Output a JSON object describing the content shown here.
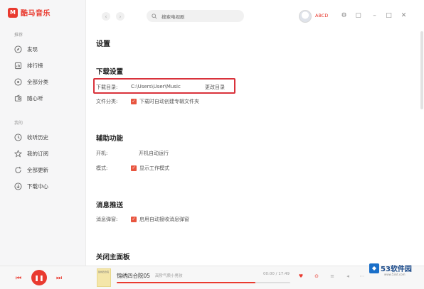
{
  "app": {
    "name": "酷马音乐",
    "logo_glyph": "M"
  },
  "sidebar": {
    "section_recommend": "推荐",
    "section_mine": "我的",
    "recommend_items": [
      {
        "label": "发现",
        "icon": "compass-icon"
      },
      {
        "label": "排行榜",
        "icon": "chart-icon"
      },
      {
        "label": "全部分类",
        "icon": "grid-icon"
      },
      {
        "label": "随心听",
        "icon": "radio-icon"
      }
    ],
    "mine_items": [
      {
        "label": "收听历史",
        "icon": "clock-icon"
      },
      {
        "label": "我的订阅",
        "icon": "star-icon"
      },
      {
        "label": "全部更新",
        "icon": "refresh-icon"
      },
      {
        "label": "下载中心",
        "icon": "download-icon"
      }
    ]
  },
  "topbar": {
    "search_value": "搜索电视剧",
    "username": "ABCD"
  },
  "settings": {
    "page_title": "设置",
    "download": {
      "title": "下载设置",
      "dir_label": "下载目录:",
      "dir_path": "C:\\Users\\User\\Music",
      "change_button": "更改目录",
      "file_group_label": "文件分类:",
      "file_group_option": "下载时自动创建专辑文件夹",
      "file_group_checked": true
    },
    "assist": {
      "title": "辅助功能",
      "startup_label": "开机:",
      "startup_option": "开机自动运行",
      "startup_checked": false,
      "mode_label": "模式:",
      "mode_option": "显示工作模式",
      "mode_checked": true
    },
    "push": {
      "title": "消息推送",
      "notify_label": "消息弹窗:",
      "notify_option": "启用自动接收消息弹窗",
      "notify_checked": true
    },
    "close_panel": {
      "title": "关闭主面板"
    }
  },
  "player": {
    "track_title": "锦绣四合院05",
    "track_subtitle": "高阶气质小男孩",
    "time": "00:00 / 17:49",
    "progress": 0.8,
    "cover_text": "锦绣四合院"
  },
  "watermark": {
    "text": "53软件园",
    "url": "www.53xt.com"
  },
  "colors": {
    "accent": "#e93a2f",
    "highlight_border": "#d9323b",
    "watermark_blue": "#1a6fc9"
  }
}
